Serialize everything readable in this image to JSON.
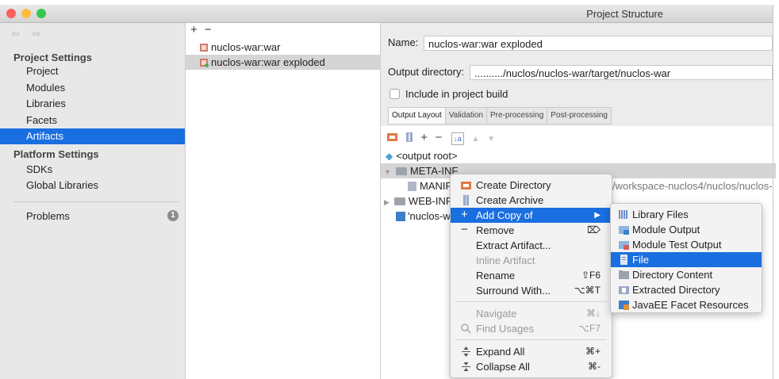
{
  "window": {
    "title": "Project Structure"
  },
  "sidebar": {
    "nav_arrows": "⇦ ⇨",
    "project_settings_header": "Project Settings",
    "platform_settings_header": "Platform Settings",
    "items": [
      {
        "label": "Project"
      },
      {
        "label": "Modules"
      },
      {
        "label": "Libraries"
      },
      {
        "label": "Facets"
      },
      {
        "label": "Artifacts"
      },
      {
        "label": "SDKs"
      },
      {
        "label": "Global Libraries"
      },
      {
        "label": "Problems"
      }
    ],
    "problems_count": "1"
  },
  "artifacts": {
    "add_label": "+",
    "remove_label": "−",
    "items": [
      {
        "label": "nuclos-war:war"
      },
      {
        "label": "nuclos-war:war exploded"
      }
    ]
  },
  "details": {
    "name_label": "Name:",
    "name_value": "nuclos-war:war exploded",
    "output_dir_label": "Output directory:",
    "output_dir_value": "........../nuclos/nuclos-war/target/nuclos-war",
    "include_label": "Include in project build",
    "tabs": [
      "Output Layout",
      "Validation",
      "Pre-processing",
      "Post-processing"
    ],
    "tree": {
      "output_root": "<output root>",
      "meta_inf": "META-INF",
      "manifest": "MANIFE",
      "web_inf": "WEB-INF",
      "nuclos_war": "'nuclos-wa",
      "path_fragment": "/workspace-nuclos4/nuclos/nuclos-"
    }
  },
  "context_menu": {
    "items": [
      {
        "label": "Create Directory",
        "shortcut": ""
      },
      {
        "label": "Create Archive",
        "shortcut": ""
      },
      {
        "label": "Add Copy of",
        "shortcut": "▶"
      },
      {
        "label": "Remove",
        "shortcut": "⌦"
      },
      {
        "label": "Extract Artifact...",
        "shortcut": ""
      },
      {
        "label": "Inline Artifact",
        "shortcut": ""
      },
      {
        "label": "Rename",
        "shortcut": "⇧F6"
      },
      {
        "label": "Surround With...",
        "shortcut": "⌥⌘T"
      },
      {
        "label": "Navigate",
        "shortcut": "⌘↓"
      },
      {
        "label": "Find Usages",
        "shortcut": "⌥F7"
      },
      {
        "label": "Expand All",
        "shortcut": "⌘+"
      },
      {
        "label": "Collapse All",
        "shortcut": "⌘-"
      }
    ]
  },
  "submenu": {
    "items": [
      {
        "label": "Library Files"
      },
      {
        "label": "Module Output"
      },
      {
        "label": "Module Test Output"
      },
      {
        "label": "File"
      },
      {
        "label": "Directory Content"
      },
      {
        "label": "Extracted Directory"
      },
      {
        "label": "JavaEE Facet Resources"
      }
    ]
  },
  "colors": {
    "accent": "#1a6fe0",
    "sidebar_bg": "#e8e8e8"
  }
}
